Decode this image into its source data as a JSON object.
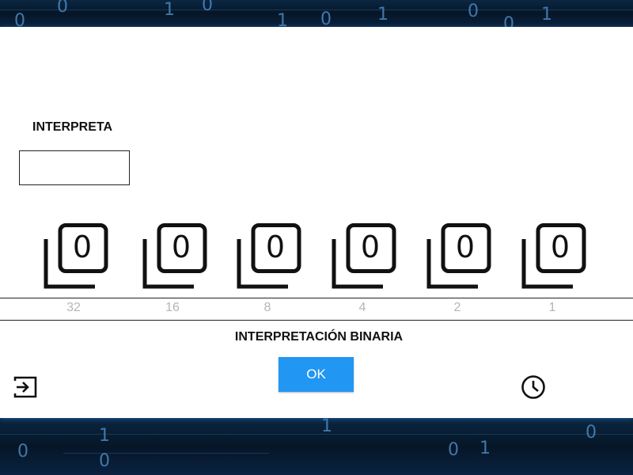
{
  "background": {
    "top_digits": [
      "0",
      "0",
      "1",
      "0",
      "1",
      "0",
      "1",
      "0",
      "1",
      "0"
    ],
    "bottom_digits": [
      "1",
      "0",
      "1",
      "0",
      "0",
      "1",
      "0"
    ]
  },
  "interpret": {
    "title": "INTERPRETA",
    "input_value": "",
    "input_placeholder": ""
  },
  "bits": [
    {
      "digit": "0",
      "weight": "32"
    },
    {
      "digit": "0",
      "weight": "16"
    },
    {
      "digit": "0",
      "weight": "8"
    },
    {
      "digit": "0",
      "weight": "4"
    },
    {
      "digit": "0",
      "weight": "2"
    },
    {
      "digit": "0",
      "weight": "1"
    }
  ],
  "footer": {
    "title": "INTERPRETACIÓN BINARIA",
    "ok_label": "OK",
    "exit_icon": "exit-icon",
    "timer_icon": "clock-icon"
  },
  "colors": {
    "accent": "#2196f3",
    "weight_text": "#b5b5b5",
    "background": "#071a2e"
  }
}
